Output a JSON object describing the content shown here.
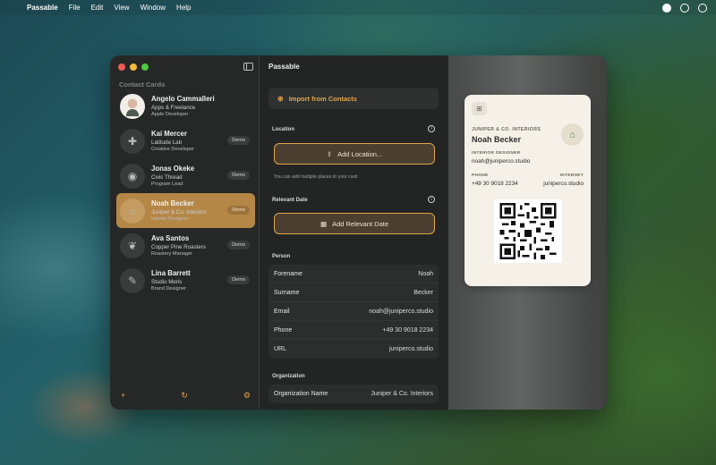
{
  "menubar": {
    "app_name": "Passable",
    "menus": [
      "File",
      "Edit",
      "View",
      "Window",
      "Help"
    ]
  },
  "sidebar": {
    "title": "Contact Cards",
    "contacts": [
      {
        "name": "Angelo Cammalleri",
        "org": "Apps & Freelance",
        "role": "Apple Developer",
        "badge": ""
      },
      {
        "name": "Kai Mercer",
        "org": "Latitude Lab",
        "role": "Creative Developer",
        "badge": "Demo"
      },
      {
        "name": "Jonas Okeke",
        "org": "Civic Thread",
        "role": "Program Lead",
        "badge": "Demo"
      },
      {
        "name": "Noah Becker",
        "org": "Juniper & Co. Interiors",
        "role": "Interior Designer",
        "badge": "Demo"
      },
      {
        "name": "Ava Santos",
        "org": "Copper Pine Roasters",
        "role": "Roastery Manager",
        "badge": "Demo"
      },
      {
        "name": "Lina Barrett",
        "org": "Studio Meris",
        "role": "Brand Designer",
        "badge": "Demo"
      }
    ],
    "footer": {
      "add": "+",
      "refresh": "↻",
      "settings": "⚙"
    }
  },
  "form": {
    "title": "Passable",
    "import_label": "Import from Contacts",
    "location": {
      "heading": "Location",
      "button": "Add Location...",
      "hint": "You can add multiple places to your card"
    },
    "relevant_date": {
      "heading": "Relevant Date",
      "button": "Add Relevant Date"
    },
    "person": {
      "heading": "Person",
      "rows": [
        {
          "label": "Forename",
          "value": "Noah"
        },
        {
          "label": "Surname",
          "value": "Becker"
        },
        {
          "label": "Email",
          "value": "noah@juniperco.studio"
        },
        {
          "label": "Phone",
          "value": "+49 30 9018 2234"
        },
        {
          "label": "URL",
          "value": "juniperco.studio"
        }
      ]
    },
    "organization": {
      "heading": "Organization",
      "rows": [
        {
          "label": "Organization Name",
          "value": "Juniper & Co. Interiors"
        }
      ]
    }
  },
  "card": {
    "company": "JUNIPER & CO. INTERIORS",
    "name": "Noah Becker",
    "role_label": "INTERIOR DESIGNER",
    "email": "noah@juniperco.studio",
    "phone_label": "PHONE",
    "phone": "+49 30 9018 2234",
    "internet_label": "INTERNET",
    "internet": "juniperco.studio"
  },
  "colors": {
    "accent": "#e3a44a",
    "selected": "#b58746",
    "card_bg": "#f5f1e8"
  }
}
